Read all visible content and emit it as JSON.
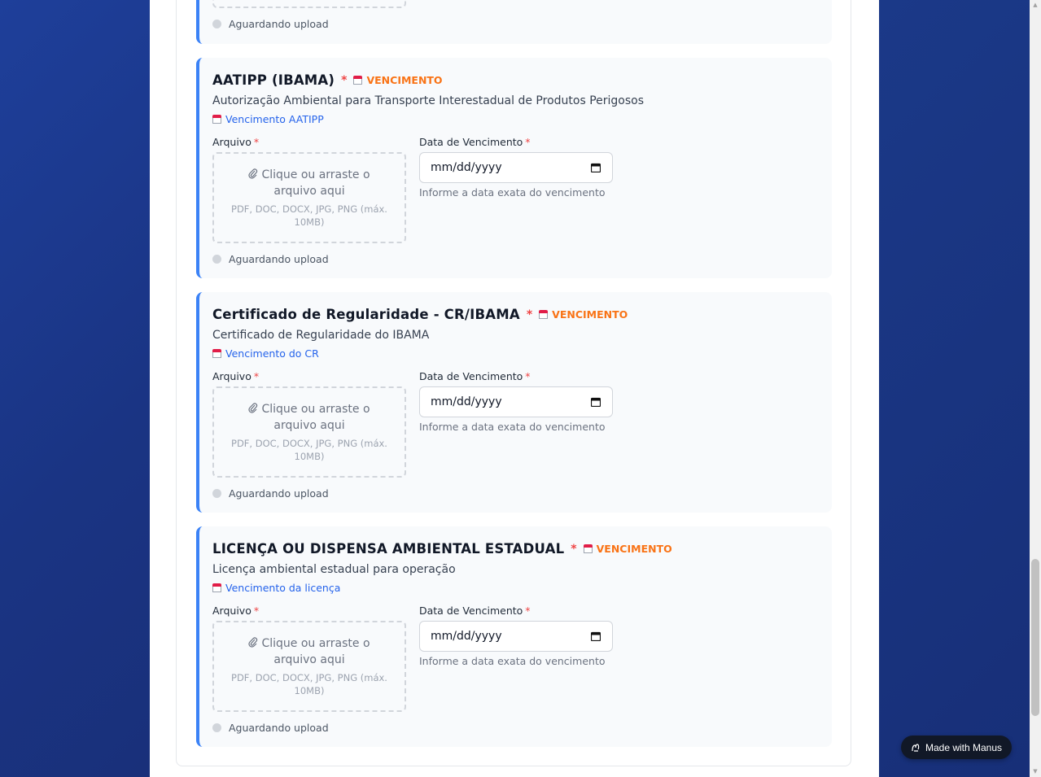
{
  "top_fragment": {
    "status": "Aguardando upload"
  },
  "common": {
    "file_label": "Arquivo",
    "date_label": "Data de Vencimento",
    "required_mark": "*",
    "badge": "VENCIMENTO",
    "dropzone_main": "Clique ou arraste o arquivo aqui",
    "dropzone_sub": "PDF, DOC, DOCX, JPG, PNG (máx. 10MB)",
    "date_placeholder": "mm/dd/yyyy",
    "date_hint": "Informe a data exata do vencimento",
    "status": "Aguardando upload"
  },
  "cards": [
    {
      "title": "AATIPP (IBAMA)",
      "description": "Autorização Ambiental para Transporte Interestadual de Produtos Perigosos",
      "link": "Vencimento AATIPP"
    },
    {
      "title": "Certificado de Regularidade - CR/IBAMA",
      "description": "Certificado de Regularidade do IBAMA",
      "link": "Vencimento do CR"
    },
    {
      "title": "LICENÇA OU DISPENSA AMBIENTAL ESTADUAL",
      "description": "Licença ambiental estadual para operação",
      "link": "Vencimento da licença"
    }
  ],
  "badge_made_with": "Made with Manus",
  "colors": {
    "accent": "#3b82f6",
    "required": "#ef4444",
    "badge": "#f97316",
    "link": "#2563eb"
  }
}
